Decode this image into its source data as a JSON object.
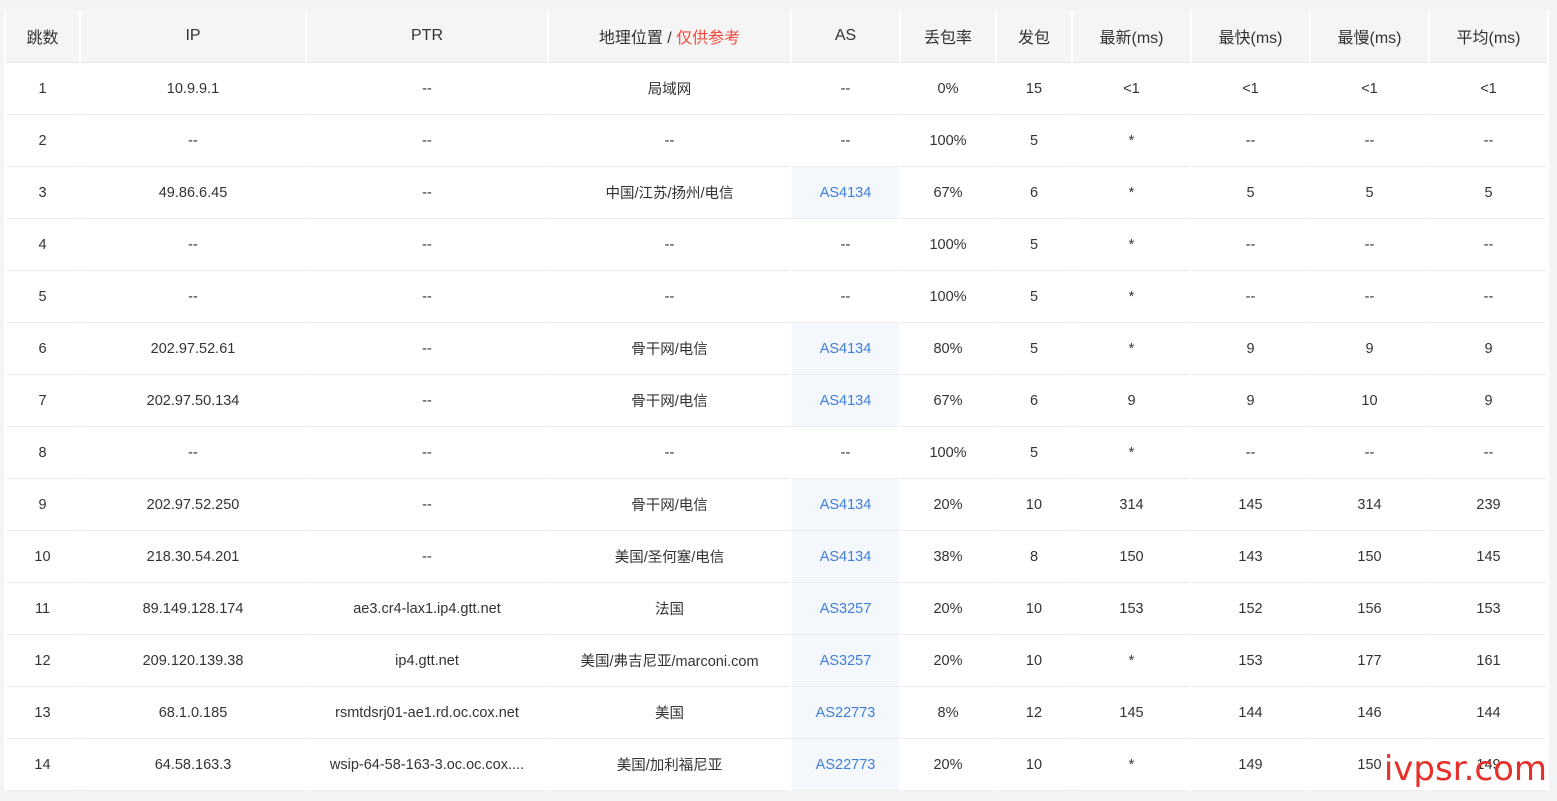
{
  "headers": {
    "hop": "跳数",
    "ip": "IP",
    "ptr": "PTR",
    "geo": "地理位置",
    "geo_sep": " / ",
    "geo_note": "仅供参考",
    "as": "AS",
    "loss": "丢包率",
    "sent": "发包",
    "last": "最新(ms)",
    "best": "最快(ms)",
    "worst": "最慢(ms)",
    "avg": "平均(ms)"
  },
  "colors": {
    "link": "#3f7fdc",
    "warn": "#f5493d",
    "watermark": "#e7302a"
  },
  "rows": [
    {
      "hop": "1",
      "ip": "10.9.9.1",
      "ptr": "--",
      "geo": "局域网",
      "as": "--",
      "loss": "0%",
      "sent": "15",
      "last": "<1",
      "best": "<1",
      "worst": "<1",
      "avg": "<1"
    },
    {
      "hop": "2",
      "ip": "--",
      "ptr": "--",
      "geo": "--",
      "as": "--",
      "loss": "100%",
      "sent": "5",
      "last": "*",
      "best": "--",
      "worst": "--",
      "avg": "--"
    },
    {
      "hop": "3",
      "ip": "49.86.6.45",
      "ptr": "--",
      "geo": "中国/江苏/扬州/电信",
      "as": "AS4134",
      "loss": "67%",
      "sent": "6",
      "last": "*",
      "best": "5",
      "worst": "5",
      "avg": "5"
    },
    {
      "hop": "4",
      "ip": "--",
      "ptr": "--",
      "geo": "--",
      "as": "--",
      "loss": "100%",
      "sent": "5",
      "last": "*",
      "best": "--",
      "worst": "--",
      "avg": "--"
    },
    {
      "hop": "5",
      "ip": "--",
      "ptr": "--",
      "geo": "--",
      "as": "--",
      "loss": "100%",
      "sent": "5",
      "last": "*",
      "best": "--",
      "worst": "--",
      "avg": "--"
    },
    {
      "hop": "6",
      "ip": "202.97.52.61",
      "ptr": "--",
      "geo": "骨干网/电信",
      "as": "AS4134",
      "loss": "80%",
      "sent": "5",
      "last": "*",
      "best": "9",
      "worst": "9",
      "avg": "9"
    },
    {
      "hop": "7",
      "ip": "202.97.50.134",
      "ptr": "--",
      "geo": "骨干网/电信",
      "as": "AS4134",
      "loss": "67%",
      "sent": "6",
      "last": "9",
      "best": "9",
      "worst": "10",
      "avg": "9"
    },
    {
      "hop": "8",
      "ip": "--",
      "ptr": "--",
      "geo": "--",
      "as": "--",
      "loss": "100%",
      "sent": "5",
      "last": "*",
      "best": "--",
      "worst": "--",
      "avg": "--"
    },
    {
      "hop": "9",
      "ip": "202.97.52.250",
      "ptr": "--",
      "geo": "骨干网/电信",
      "as": "AS4134",
      "loss": "20%",
      "sent": "10",
      "last": "314",
      "best": "145",
      "worst": "314",
      "avg": "239"
    },
    {
      "hop": "10",
      "ip": "218.30.54.201",
      "ptr": "--",
      "geo": "美国/圣何塞/电信",
      "as": "AS4134",
      "loss": "38%",
      "sent": "8",
      "last": "150",
      "best": "143",
      "worst": "150",
      "avg": "145"
    },
    {
      "hop": "11",
      "ip": "89.149.128.174",
      "ptr": "ae3.cr4-lax1.ip4.gtt.net",
      "geo": "法国",
      "as": "AS3257",
      "loss": "20%",
      "sent": "10",
      "last": "153",
      "best": "152",
      "worst": "156",
      "avg": "153"
    },
    {
      "hop": "12",
      "ip": "209.120.139.38",
      "ptr": "ip4.gtt.net",
      "geo": "美国/弗吉尼亚/marconi.com",
      "as": "AS3257",
      "loss": "20%",
      "sent": "10",
      "last": "*",
      "best": "153",
      "worst": "177",
      "avg": "161"
    },
    {
      "hop": "13",
      "ip": "68.1.0.185",
      "ptr": "rsmtdsrj01-ae1.rd.oc.cox.net",
      "geo": "美国",
      "as": "AS22773",
      "loss": "8%",
      "sent": "12",
      "last": "145",
      "best": "144",
      "worst": "146",
      "avg": "144"
    },
    {
      "hop": "14",
      "ip": "64.58.163.3",
      "ptr": "wsip-64-58-163-3.oc.oc.cox....",
      "geo": "美国/加利福尼亚",
      "as": "AS22773",
      "loss": "20%",
      "sent": "10",
      "last": "*",
      "best": "149",
      "worst": "150",
      "avg": "149"
    }
  ],
  "watermark": "ivpsr.com"
}
